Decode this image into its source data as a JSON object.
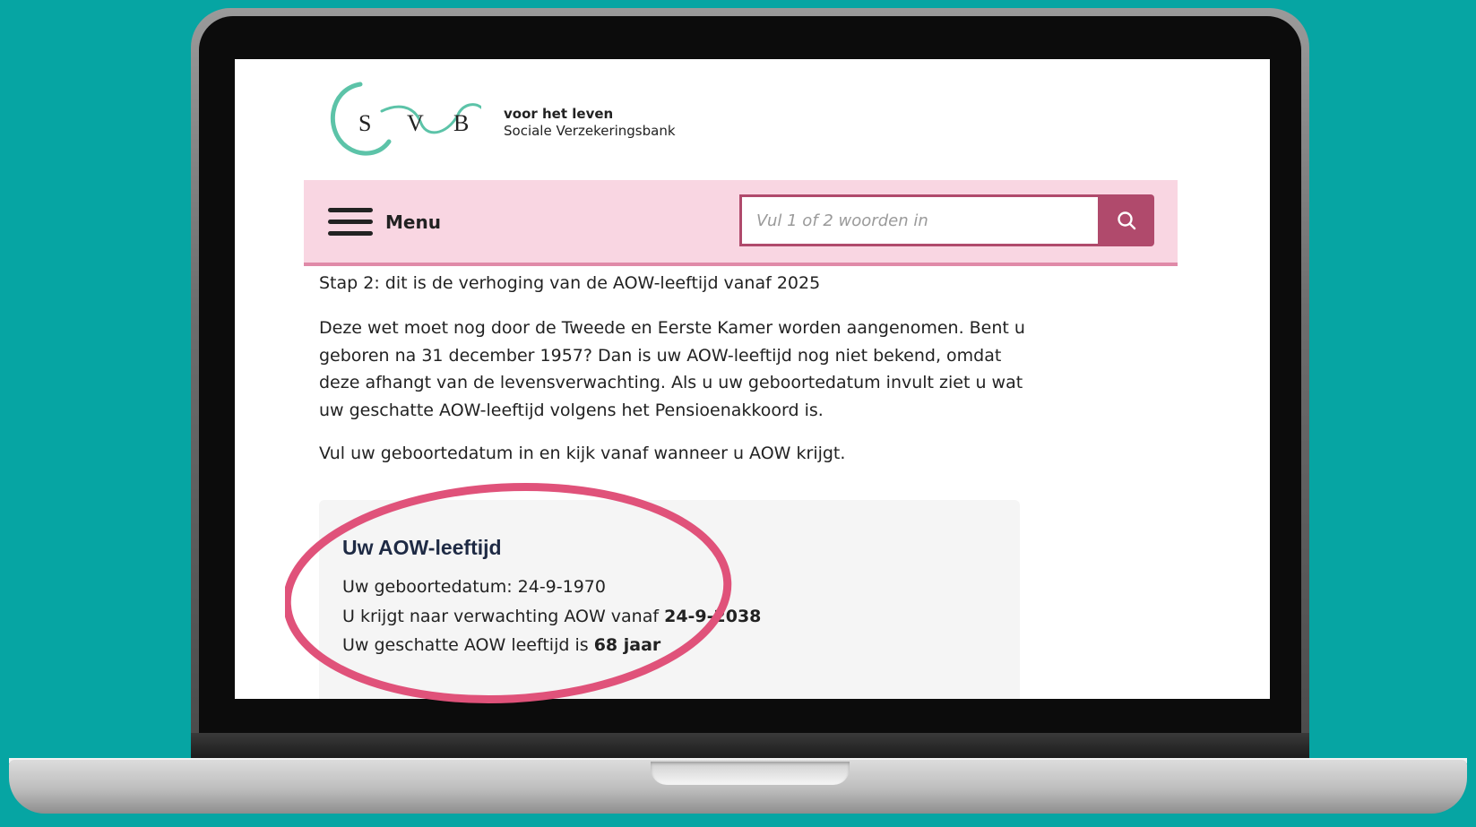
{
  "logo": {
    "letters": [
      "S",
      "V",
      "B"
    ]
  },
  "header": {
    "tagline": "voor het leven",
    "org_name": "Sociale Verzekeringsbank"
  },
  "nav": {
    "menu_label": "Menu",
    "search_placeholder": "Vul 1 of 2 woorden in"
  },
  "content": {
    "step": "Stap 2: dit is de verhoging van de AOW-leeftijd vanaf 2025",
    "paragraph": "Deze wet moet nog door de Tweede en Eerste Kamer worden aangenomen. Bent u geboren na 31 december 1957? Dan is uw AOW-leeftijd nog niet bekend, omdat deze afhangt van de levensverwachting. Als u uw geboortedatum invult ziet u wat uw geschatte AOW-leeftijd volgens het Pensioenakkoord is.",
    "instruction": "Vul uw geboortedatum in en kijk vanaf wanneer u AOW krijgt."
  },
  "result": {
    "title": "Uw AOW-leeftijd",
    "birthdate_label": "Uw geboortedatum: ",
    "birthdate": "24-9-1970",
    "aow_from_label": "U krijgt naar verwachting AOW vanaf ",
    "aow_from": "24-9-2038",
    "age_label": "Uw geschatte AOW leeftijd is ",
    "age": "68 jaar"
  },
  "colors": {
    "background": "#06a5a3",
    "nav_bg": "#f9d6e2",
    "accent": "#b04a6c",
    "logo_green": "#5cc3a8",
    "highlight_circle": "#e0527a"
  }
}
